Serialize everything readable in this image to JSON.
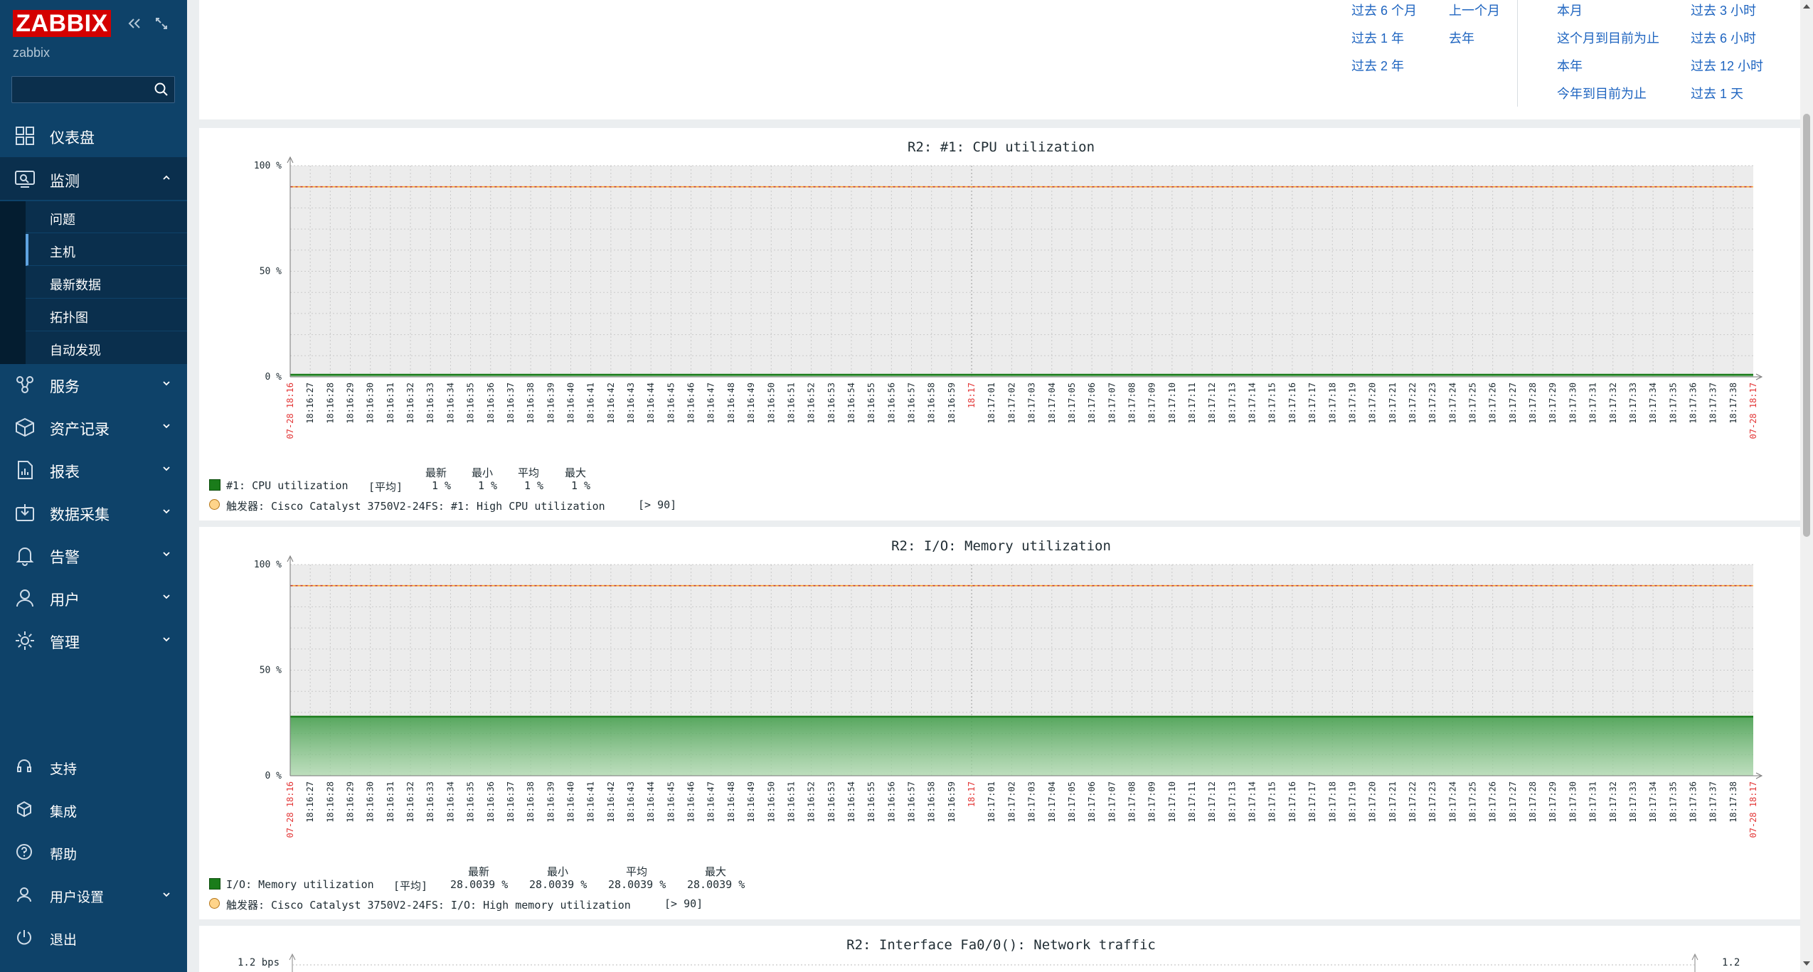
{
  "app": {
    "logo": "ZABBIX",
    "server_name": "zabbix"
  },
  "sidebar": {
    "search_placeholder": "",
    "menu": [
      {
        "label": "仪表盘",
        "icon": "dashboard-icon"
      },
      {
        "label": "监测",
        "icon": "monitoring-icon",
        "expanded": true
      },
      {
        "label": "服务",
        "icon": "services-icon"
      },
      {
        "label": "资产记录",
        "icon": "inventory-icon"
      },
      {
        "label": "报表",
        "icon": "reports-icon"
      },
      {
        "label": "数据采集",
        "icon": "data-collection-icon"
      },
      {
        "label": "告警",
        "icon": "alerts-icon"
      },
      {
        "label": "用户",
        "icon": "users-icon"
      },
      {
        "label": "管理",
        "icon": "administration-icon"
      }
    ],
    "monitoring_submenu": [
      "问题",
      "主机",
      "最新数据",
      "拓扑图",
      "自动发现"
    ],
    "selected_submenu": "主机",
    "bottom": [
      {
        "label": "支持",
        "icon": "support-icon"
      },
      {
        "label": "集成",
        "icon": "integrations-icon"
      },
      {
        "label": "帮助",
        "icon": "help-icon"
      },
      {
        "label": "用户设置",
        "icon": "user-settings-icon"
      },
      {
        "label": "退出",
        "icon": "signout-icon"
      }
    ]
  },
  "time_presets": {
    "col1": [
      "过去 6 个月",
      "过去 1 年",
      "过去 2 年"
    ],
    "col2": [
      "上一个月",
      "去年"
    ],
    "col3": [
      "本月",
      "这个月到目前为止",
      "本年",
      "今年到目前为止"
    ],
    "col4": [
      "过去 3 小时",
      "过去 6 小时",
      "过去 12 小时",
      "过去 1 天"
    ]
  },
  "graphs": [
    {
      "title": "R2: #1: CPU utilization",
      "y_ticks": [
        "100 %",
        "50 %",
        "0 %"
      ],
      "legend_header": {
        "last": "最新",
        "min": "最小",
        "avg": "平均",
        "max": "最大"
      },
      "series_label": "#1: CPU utilization",
      "series_func": "[平均]",
      "series_values": {
        "last": "1 %",
        "min": "1 %",
        "avg": "1 %",
        "max": "1 %"
      },
      "trigger_label": "触发器: Cisco Catalyst 3750V2-24FS: #1: High CPU utilization",
      "trigger_cond": "[> 90]"
    },
    {
      "title": "R2: I/O: Memory utilization",
      "y_ticks": [
        "100 %",
        "50 %",
        "0 %"
      ],
      "legend_header": {
        "last": "最新",
        "min": "最小",
        "avg": "平均",
        "max": "最大"
      },
      "series_label": "I/O: Memory utilization",
      "series_func": "[平均]",
      "series_values": {
        "last": "28.0039 %",
        "min": "28.0039 %",
        "avg": "28.0039 %",
        "max": "28.0039 %"
      },
      "trigger_label": "触发器: Cisco Catalyst 3750V2-24FS: I/O: High memory utilization",
      "trigger_cond": "[> 90]"
    },
    {
      "title": "R2: Interface Fa0/0(): Network traffic",
      "y_left_top": "1.2 bps",
      "y_right_top": "1.2"
    }
  ],
  "x_axis": {
    "start_label": "07-28 18:16",
    "end_label": "07-28 18:17",
    "mid_label": "18:17",
    "ticks": [
      "18:16:27",
      "18:16:28",
      "18:16:29",
      "18:16:30",
      "18:16:31",
      "18:16:32",
      "18:16:33",
      "18:16:34",
      "18:16:35",
      "18:16:36",
      "18:16:37",
      "18:16:38",
      "18:16:39",
      "18:16:40",
      "18:16:41",
      "18:16:42",
      "18:16:43",
      "18:16:44",
      "18:16:45",
      "18:16:46",
      "18:16:47",
      "18:16:48",
      "18:16:49",
      "18:16:50",
      "18:16:51",
      "18:16:52",
      "18:16:53",
      "18:16:54",
      "18:16:55",
      "18:16:56",
      "18:16:57",
      "18:16:58",
      "18:16:59",
      "18:17",
      "18:17:01",
      "18:17:02",
      "18:17:03",
      "18:17:04",
      "18:17:05",
      "18:17:06",
      "18:17:07",
      "18:17:08",
      "18:17:09",
      "18:17:10",
      "18:17:11",
      "18:17:12",
      "18:17:13",
      "18:17:14",
      "18:17:15",
      "18:17:16",
      "18:17:17",
      "18:17:18",
      "18:17:19",
      "18:17:20",
      "18:17:21",
      "18:17:22",
      "18:17:23",
      "18:17:24",
      "18:17:25",
      "18:17:26",
      "18:17:27",
      "18:17:28",
      "18:17:29",
      "18:17:30",
      "18:17:31",
      "18:17:32",
      "18:17:33",
      "18:17:34",
      "18:17:35",
      "18:17:36",
      "18:17:37",
      "18:17:38"
    ]
  },
  "chart_data": [
    {
      "type": "area",
      "title": "R2: #1: CPU utilization",
      "ylim": [
        0,
        100
      ],
      "series": [
        {
          "name": "#1: CPU utilization",
          "values": [
            1
          ]
        }
      ],
      "threshold": 90
    },
    {
      "type": "area",
      "title": "R2: I/O: Memory utilization",
      "ylim": [
        0,
        100
      ],
      "series": [
        {
          "name": "I/O: Memory utilization",
          "values": [
            28.0039
          ]
        }
      ],
      "threshold": 90
    }
  ],
  "colors": {
    "sidebar_bg": "#0e4269",
    "logo_red": "#d40000",
    "link_blue": "#1f65c0",
    "series_green": "#1a7c1a",
    "trigger_orange": "#ffa630",
    "tick_red": "#e33737"
  }
}
